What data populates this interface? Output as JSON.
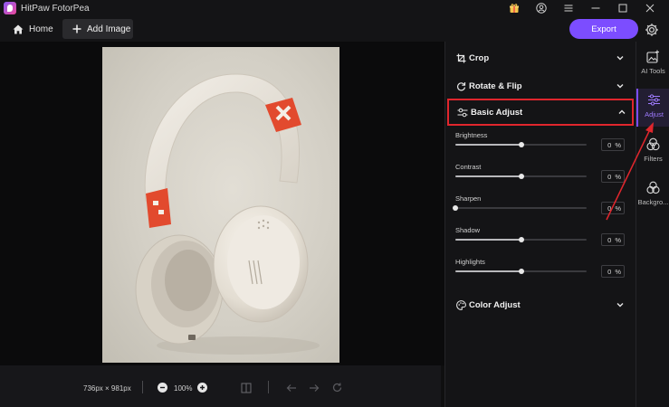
{
  "app": {
    "title": "HitPaw FotorPea"
  },
  "toolbar": {
    "home_label": "Home",
    "add_image_label": "Add Image",
    "export_label": "Export"
  },
  "canvas": {
    "dimensions": "736px × 981px",
    "zoom": "100%"
  },
  "panel": {
    "crop_label": "Crop",
    "rotate_label": "Rotate & Flip",
    "basic_adjust_label": "Basic Adjust",
    "color_adjust_label": "Color Adjust",
    "sliders": [
      {
        "label": "Brightness",
        "value": "0",
        "unit": "%",
        "level": 0.5
      },
      {
        "label": "Contrast",
        "value": "0",
        "unit": "%",
        "level": 0.5
      },
      {
        "label": "Sharpen",
        "value": "0",
        "unit": "%",
        "level": 0.0
      },
      {
        "label": "Shadow",
        "value": "0",
        "unit": "%",
        "level": 0.5
      },
      {
        "label": "Highlights",
        "value": "0",
        "unit": "%",
        "level": 0.5
      }
    ]
  },
  "rail": {
    "items": [
      {
        "label": "AI Tools",
        "icon": "ai-tools-icon"
      },
      {
        "label": "Adjust",
        "icon": "adjust-icon",
        "active": true
      },
      {
        "label": "Filters",
        "icon": "filters-icon"
      },
      {
        "label": "Backgro...",
        "icon": "background-icon"
      }
    ]
  },
  "colors": {
    "accent": "#7c4dff",
    "highlight_box": "#e0262d",
    "background": "#141416"
  }
}
